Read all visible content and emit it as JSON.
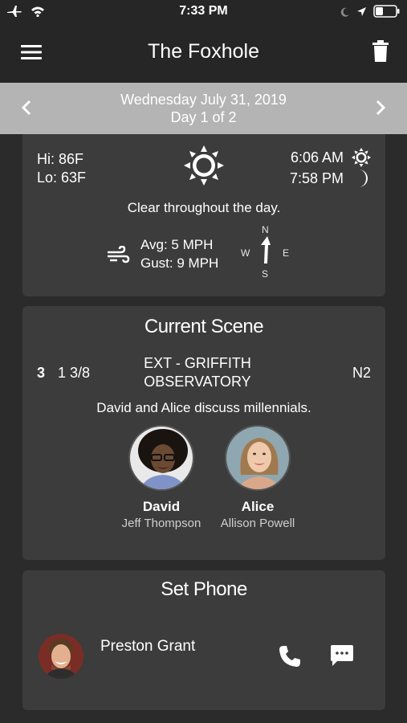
{
  "status_bar": {
    "time": "7:33 PM"
  },
  "nav": {
    "title": "The Foxhole"
  },
  "date_bar": {
    "date": "Wednesday July 31, 2019",
    "day": "Day 1 of 2"
  },
  "weather": {
    "hi": "Hi: 86F",
    "lo": "Lo: 63F",
    "sunrise": "6:06 AM",
    "sunset": "7:58 PM",
    "description": "Clear throughout the day.",
    "wind_avg": "Avg: 5 MPH",
    "wind_gust": "Gust: 9 MPH",
    "compass": {
      "n": "N",
      "s": "S",
      "e": "E",
      "w": "W"
    },
    "icons": {
      "condition": "sun-icon",
      "sunrise": "sunrise-icon",
      "sunset": "moon-icon",
      "wind": "wind-icon"
    }
  },
  "scene": {
    "title": "Current Scene",
    "number": "3",
    "pages": "1 3/8",
    "location": "EXT - GRIFFITH OBSERVATORY",
    "time_of_day": "N2",
    "description": "David and Alice discuss millennials.",
    "cast": [
      {
        "role": "David",
        "actor": "Jeff Thompson"
      },
      {
        "role": "Alice",
        "actor": "Allison Powell"
      }
    ]
  },
  "set_phone": {
    "title": "Set Phone",
    "name": "Preston Grant"
  },
  "colors": {
    "background": "#2b2b2b",
    "nav_background": "#262626",
    "date_bar": "#b4b4b4",
    "card": "#3c3c3c"
  }
}
